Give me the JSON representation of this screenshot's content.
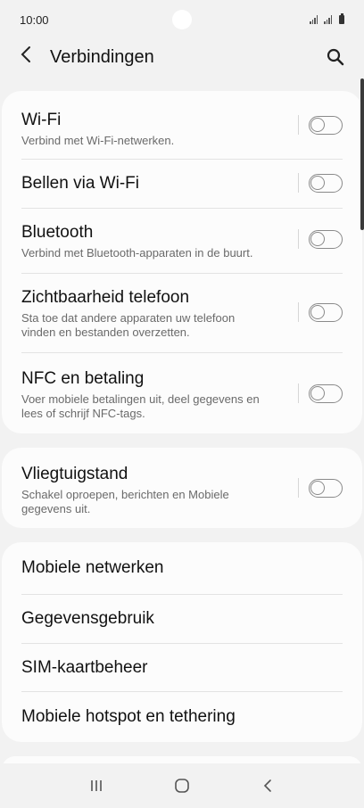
{
  "status_bar": {
    "time": "10:00"
  },
  "header": {
    "title": "Verbindingen"
  },
  "group1": [
    {
      "title": "Wi-Fi",
      "subtitle": "Verbind met Wi-Fi-netwerken.",
      "enabled": false
    },
    {
      "title": "Bellen via Wi-Fi",
      "subtitle": "",
      "enabled": false
    },
    {
      "title": "Bluetooth",
      "subtitle": "Verbind met Bluetooth-apparaten in de buurt.",
      "enabled": false
    },
    {
      "title": "Zichtbaarheid telefoon",
      "subtitle_lines": [
        "Sta toe dat andere apparaten uw telefoon",
        "vinden en bestanden overzetten."
      ],
      "enabled": false
    },
    {
      "title": "NFC en betaling",
      "subtitle_lines": [
        "Voer mobiele betalingen uit, deel gegevens en",
        "lees of schrijf NFC-tags."
      ],
      "enabled": false
    }
  ],
  "group2": [
    {
      "title": "Vliegtuigstand",
      "subtitle_lines": [
        "Schakel oproepen, berichten en Mobiele",
        "gegevens uit."
      ],
      "enabled": false
    }
  ],
  "group3": [
    {
      "title": "Mobiele netwerken"
    },
    {
      "title": "Gegevensgebruik"
    },
    {
      "title": "SIM-kaartbeheer"
    },
    {
      "title": "Mobiele hotspot en tethering"
    }
  ],
  "icons": {
    "back": "chevron-left-icon",
    "search": "search-icon",
    "nav_recent": "recent-apps-icon",
    "nav_home": "home-icon",
    "nav_back": "back-icon"
  }
}
